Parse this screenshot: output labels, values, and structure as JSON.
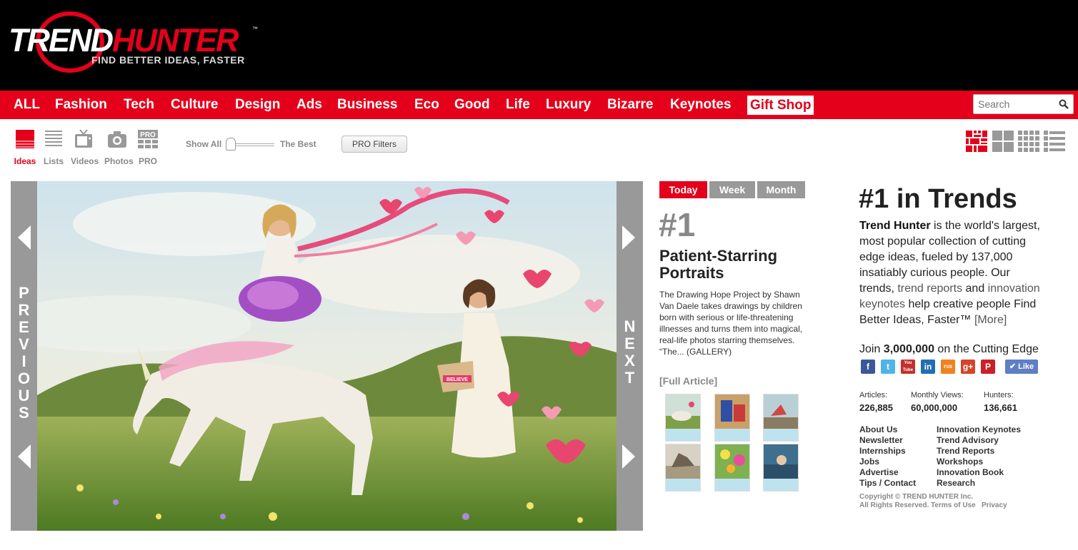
{
  "logo": {
    "word1": "TREND",
    "word2": "HUNTER",
    "tm": "™",
    "tagline": "FIND BETTER IDEAS, FASTER"
  },
  "nav": {
    "items": [
      "ALL",
      "Fashion",
      "Tech",
      "Culture",
      "Design",
      "Ads",
      "Business",
      "Eco",
      "Good",
      "Life",
      "Luxury",
      "Bizarre",
      "Keynotes"
    ],
    "gift_shop": "Gift Shop",
    "search_placeholder": "Search"
  },
  "toolbar": {
    "formats": [
      "Ideas",
      "Lists",
      "Videos",
      "Photos",
      "PRO"
    ],
    "pro_badge": "PRO",
    "show_all": "Show All",
    "the_best": "The Best",
    "pro_filters": "PRO Filters"
  },
  "slideshow": {
    "previous": "PREVIOUS",
    "next": "NEXT",
    "sign_text": "BELIEVE"
  },
  "feature": {
    "tabs": [
      "Today",
      "Week",
      "Month"
    ],
    "rank": "#1",
    "title": "Patient-Starring Portraits",
    "description": "The Drawing Hope Project by Shawn Van Daele takes drawings by children born with serious or life-threatening illnesses and turns them into magical, real-life photos starring themselves.  “The... (GALLERY)",
    "full_article": "[Full Article]"
  },
  "sidebar": {
    "title": "#1 in Trends",
    "blurb": {
      "brand": "Trend Hunter",
      "p1": " is the world's largest, most popular collection of cutting edge ideas, fueled by 137,000 insatiably curious people. Our trends, ",
      "link1": "trend reports",
      "p2": " and ",
      "link2": "innovation keynotes",
      "p3": " help creative people Find Better Ideas, Faster™ ",
      "more": "[More]"
    },
    "join": {
      "prefix": "Join ",
      "count": "3,000,000",
      "suffix": " on the Cutting Edge"
    },
    "social": [
      "f",
      "t",
      "You Tube",
      "in",
      "rss",
      "g+",
      "P"
    ],
    "like": "Like",
    "stats": [
      {
        "label": "Articles:",
        "value": "226,885"
      },
      {
        "label": "Monthly Views:",
        "value": "60,000,000"
      },
      {
        "label": "Hunters:",
        "value": "136,661"
      }
    ],
    "links_left": [
      "About Us",
      "Newsletter",
      "Internships",
      "Jobs",
      "Advertise",
      "Tips / Contact"
    ],
    "links_right": [
      "Innovation Keynotes",
      "Trend Advisory",
      "Trend Reports",
      "Workshops",
      "Innovation Book",
      "Research"
    ],
    "copyright": "Copyright © TREND HUNTER Inc.",
    "rights": "All Rights Reserved.",
    "terms": "Terms of Use",
    "privacy": "Privacy"
  },
  "colors": {
    "brand_red": "#e4001b",
    "header_black": "#000000",
    "grey": "#999999"
  }
}
